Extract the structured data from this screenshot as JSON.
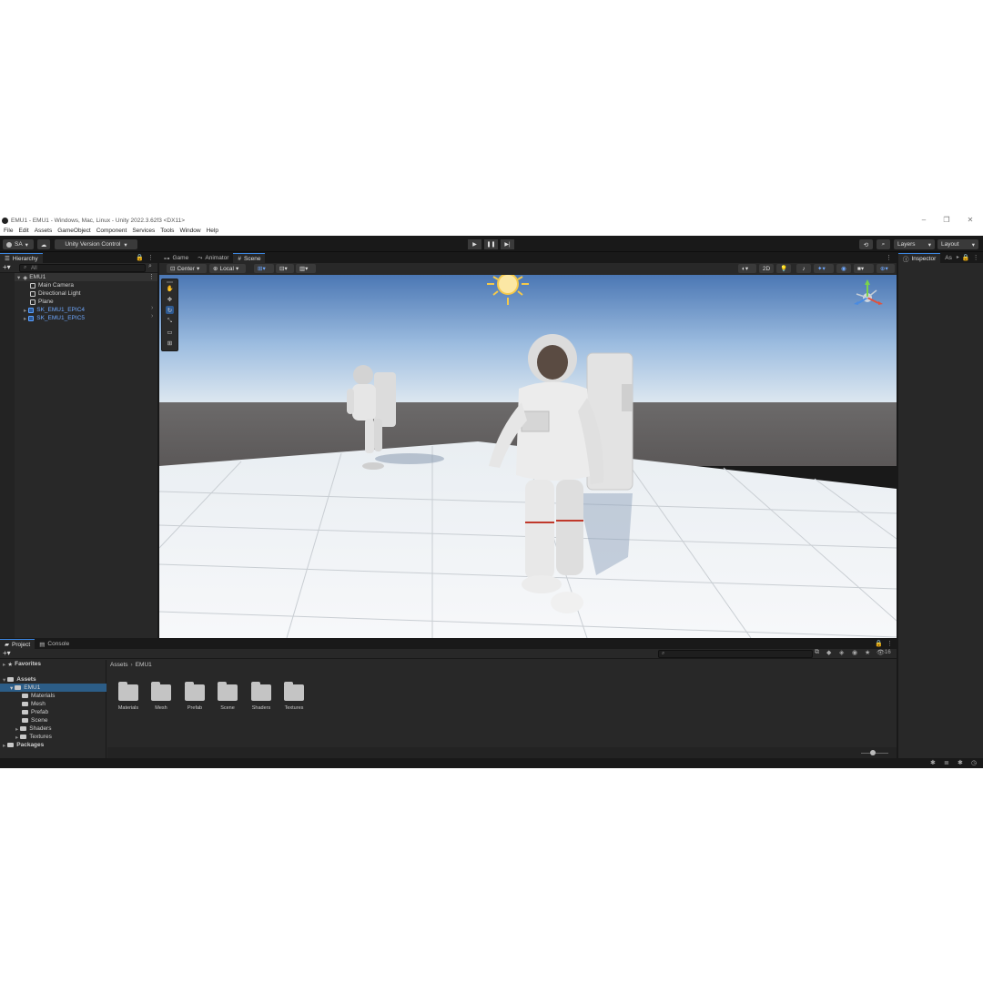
{
  "window": {
    "title": "EMU1 - EMU1 - Windows, Mac, Linux - Unity 2022.3.62f3 <DX11>",
    "minimize": "–",
    "restore": "❐",
    "close": "✕"
  },
  "menu": [
    "File",
    "Edit",
    "Assets",
    "GameObject",
    "Component",
    "Services",
    "Tools",
    "Window",
    "Help"
  ],
  "toolbar": {
    "account": "SA",
    "version_control": "Unity Version Control",
    "layers": "Layers",
    "layout": "Layout"
  },
  "hierarchy": {
    "tab": "Hierarchy",
    "search_placeholder": "All",
    "scene": "EMU1",
    "items": [
      "Main Camera",
      "Directional Light",
      "Plane",
      "SK_EMU1_EPIC4",
      "SK_EMU1_EPIC5"
    ]
  },
  "scene_tabs": [
    "Game",
    "Animator",
    "Scene"
  ],
  "scene_toolbar": {
    "pivot": "Center",
    "space": "Local",
    "mode_2d": "2D"
  },
  "inspector": {
    "tab": "Inspector",
    "tab2": "As"
  },
  "project": {
    "tabs": [
      "Project",
      "Console"
    ],
    "favorites": "Favorites",
    "assets": "Assets",
    "emu1": "EMU1",
    "folders": [
      "Materials",
      "Mesh",
      "Prefab",
      "Scene",
      "Shaders",
      "Textures"
    ],
    "packages": "Packages",
    "breadcrumb_root": "Assets",
    "breadcrumb_sep": "›",
    "breadcrumb_current": "EMU1",
    "grid": [
      "Materials",
      "Mesh",
      "Prefab",
      "Scene",
      "Shaders",
      "Textures"
    ],
    "count": "16"
  }
}
